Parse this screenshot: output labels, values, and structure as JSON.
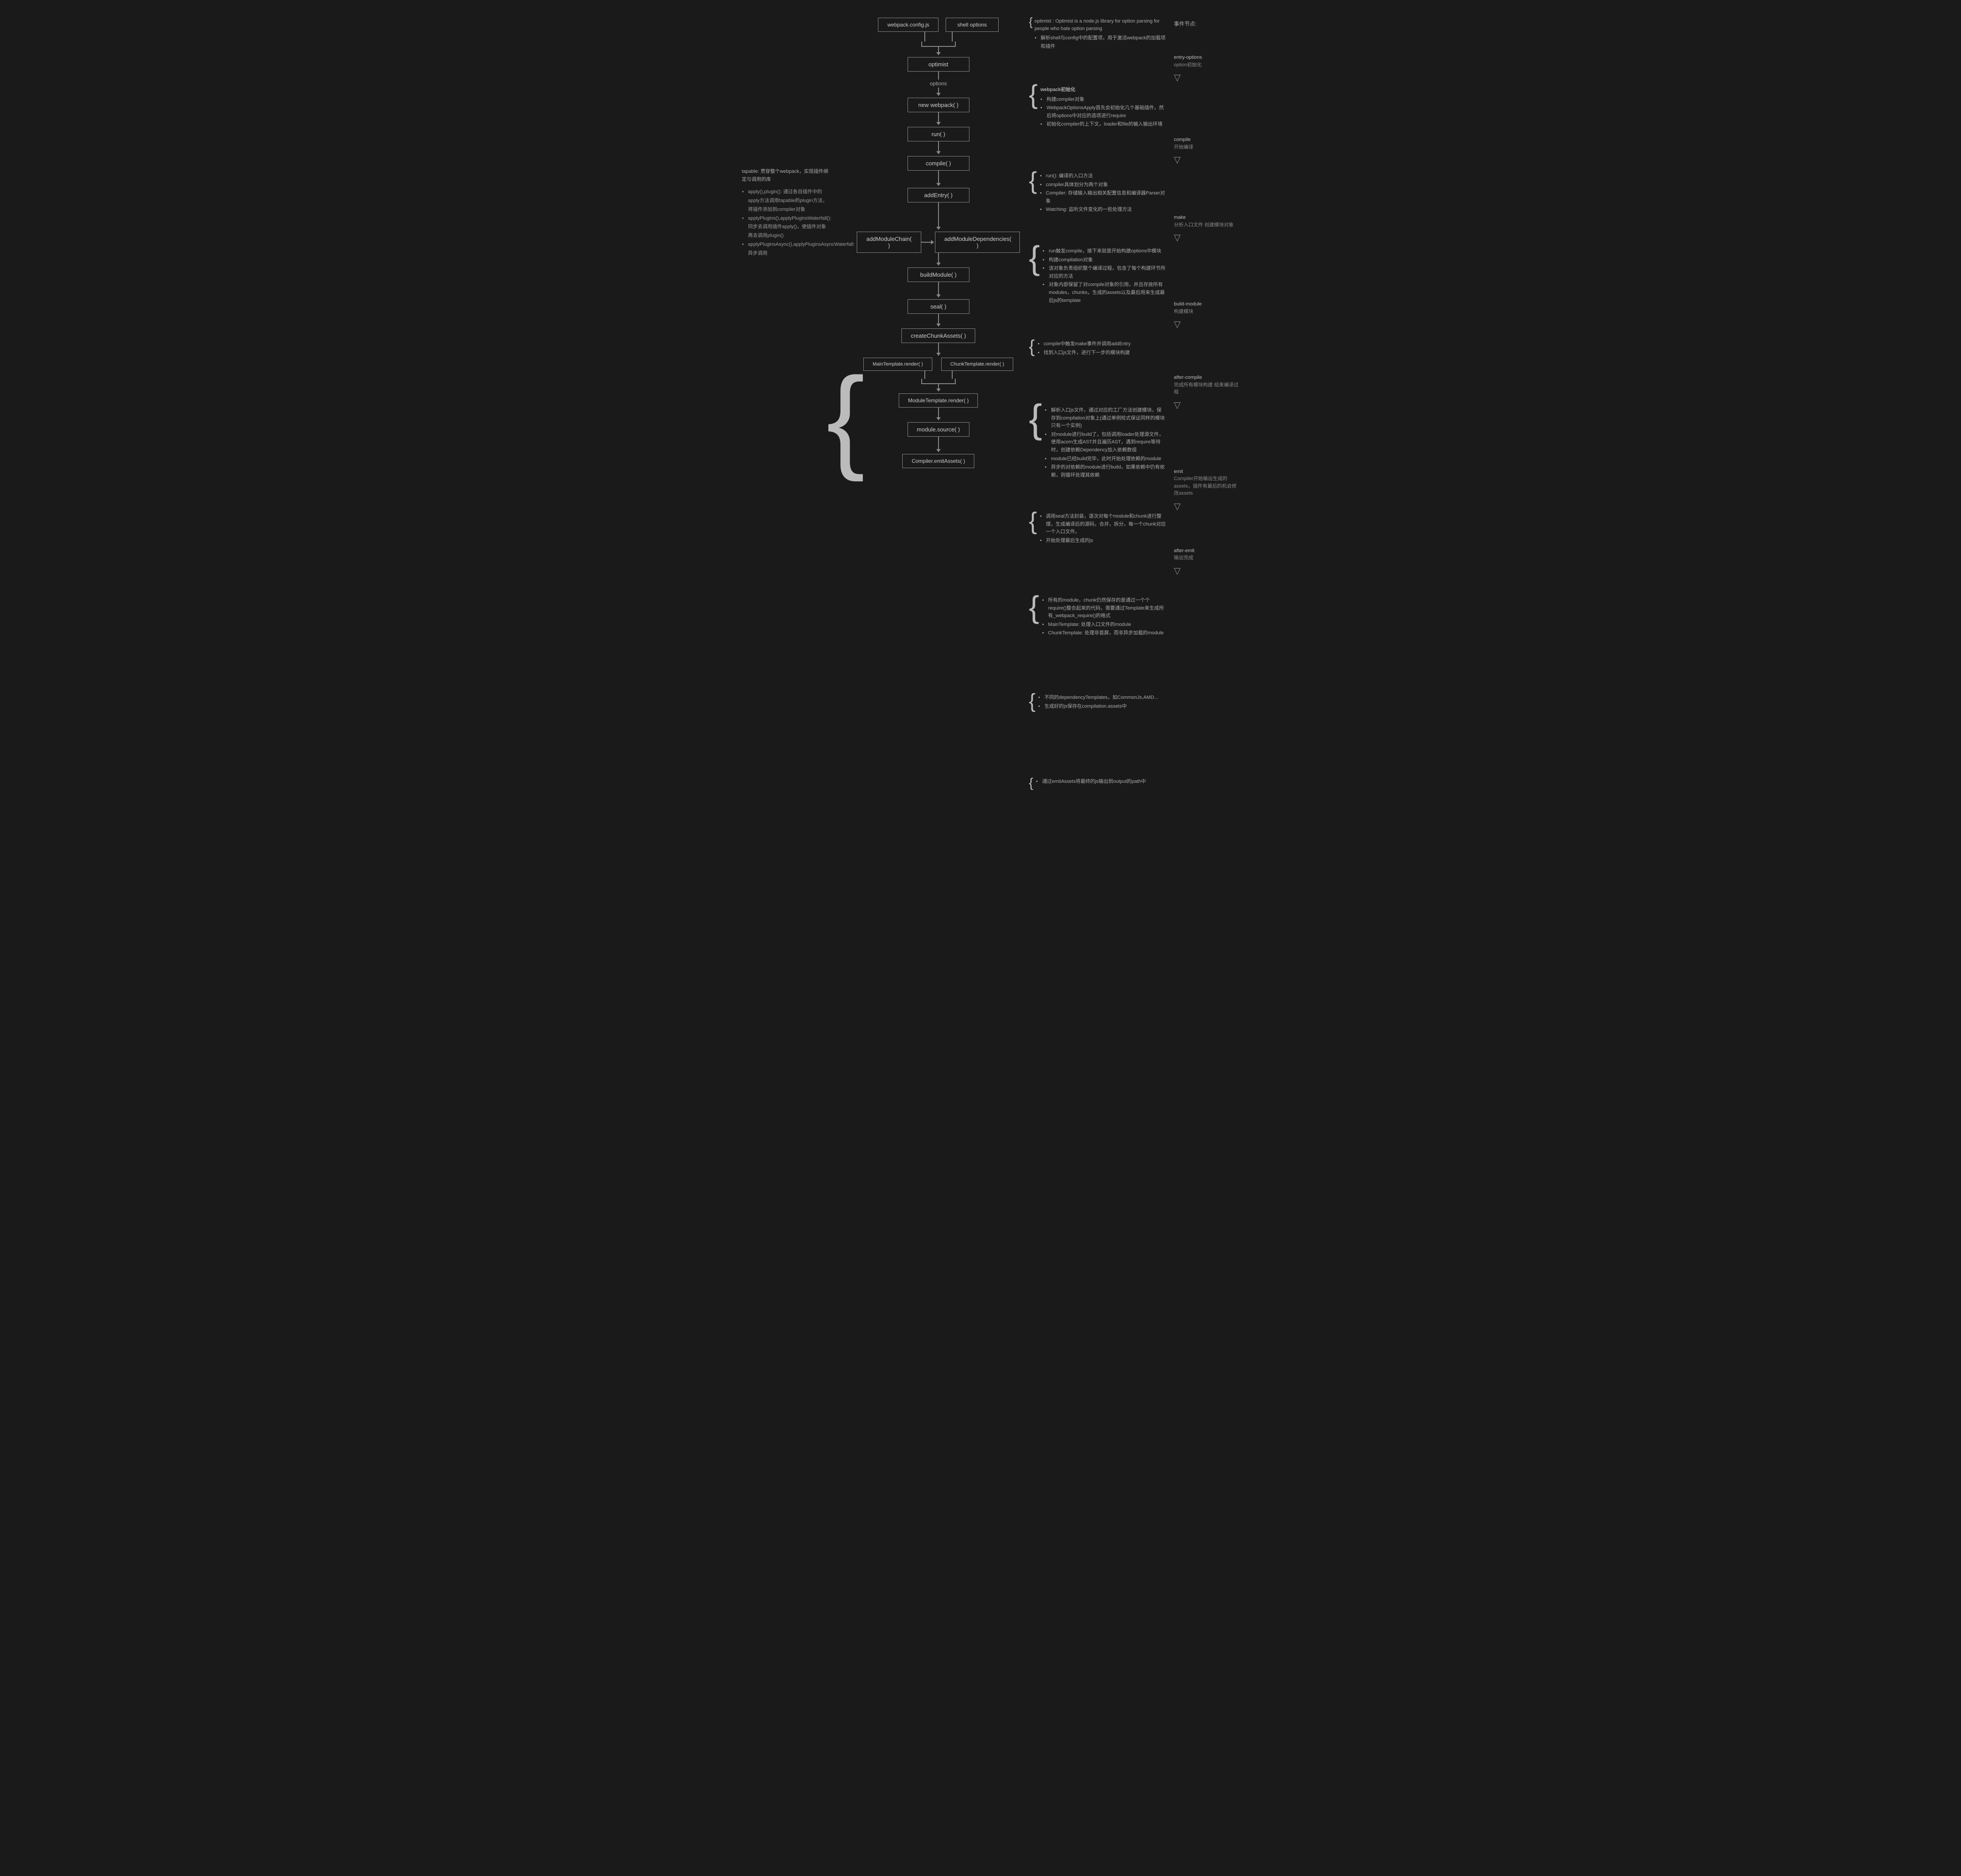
{
  "header": {
    "nodes": {
      "webpack_config": "webpack.config.js",
      "shell_options": "shell options",
      "optimist": "optimist",
      "new_webpack": "new webpack( )",
      "run": "run( )",
      "compile": "compile( )",
      "addEntry": "addEntry( )",
      "addModuleChain": "addModuleChain( )",
      "addModuleDependencies": "addModuleDependencies( )",
      "buildModule": "buildModule( )",
      "seal": "seal( )",
      "createChunkAssets": "createChunkAssets( )",
      "mainTemplateRender": "MainTemplate.render( )",
      "chunkTemplateRender": "ChunkTemplate.render( )",
      "moduleTemplateRender": "ModuleTemplate.render( )",
      "moduleSource": "module.source( )",
      "compilerEmitAssets": "Compiler.emitAssets( )"
    },
    "options_label": "options"
  },
  "left_panel": {
    "tapable_title": "tapable: 贯穿整个webpack，实现插件绑定与调用的库",
    "items": [
      "apply(),plugin(): 通过各自插件中的apply方法调用tapable的plugin方法，将插件添加到compiler对象",
      "applyPlugins(),applyPluginsWaterfall(): 同步去调用插件apply()，使插件对象再去调用plugin()",
      "applyPluginsAsync(),applyPluginsAsyncWaterfall: 异步调用"
    ]
  },
  "notes": {
    "optimist_note": {
      "title": "optimist : Optimist is a node.js library for option parsing for people who hate option parsing",
      "sub": "解析shell与config中的配置项，用于激活webpack的加载项和插件"
    },
    "new_webpack_note": {
      "title": "webpack初始化",
      "items": [
        "构建compiler对象",
        "WebpackOptionsApply首先会初始化几个基础插件，然后将options中对应的选项进行require",
        "初始化compiler的上下文，loader和file的输入输出环境"
      ]
    },
    "run_note": {
      "items": [
        "run(): 编译的入口方法",
        "compiler具体划分为两个对象",
        "Compiler: 存储输入输出相关配置信息和编译器Parser对象",
        "Watching: 监听文件变化的一些处理方法"
      ]
    },
    "compile_note": {
      "items": [
        "run触发compile，接下来就是开始构建options中模块",
        "构建compilation对象",
        "该对象负责组织整个编译过程，包含了每个构建环节所对应的方法",
        "对象内部保留了对compile对象的引用，并且存放所有modules，chunks，生成的assets以及最后用来生成最后js的template"
      ]
    },
    "addEntry_note": {
      "items": [
        "compile中触发make事件并调用addEntry",
        "找到入口js文件，进行下一步的模块构建"
      ]
    },
    "addModuleDeps_note": {
      "items": [
        "解析入口js文件，通过对应的工厂方法创建模块，保存到compilation对象上(通过单例校式保证同样的模块只有一个实例)",
        "对module进行build了，包括调用loader处理源文件，使用acorn生成AST并且遍历AST，遇到require等待时，创建依赖Dependency加入依赖数组",
        "module已经build完毕，此时开始处理依赖的module",
        "异步的对依赖的module进行build，如果依赖中仍有依赖，则循环处理其依赖"
      ]
    },
    "seal_note": {
      "items": [
        "调用seal方法封装，逐次对每个module和chunk进行整理，生成编译后的源码，合并，拆分，每一个chunk对应一个入口文件。",
        "开始处理最后生成的js"
      ]
    },
    "emit_note": {
      "items": [
        "所有的module，chunk仍然保存的是通过一个个require()整合起来的代码，需要通过Template来生成所有_webpack_require()的格式",
        "MainTemplate: 处理入口文件的module",
        "ChunkTemplate: 处理非首屏，而非异步加载的module"
      ]
    },
    "moduleTemplate_note": {
      "items": [
        "不同的dependencyTemplates，如CommonJs,AMD...",
        "生成好的js保存在compilation.assets中"
      ]
    },
    "compiler_emit_note": {
      "items": [
        "通过emitAssets将最终的js输出到output的path中"
      ]
    }
  },
  "right_events": {
    "entry_options": {
      "event": "entry-options",
      "desc": "option初始化"
    },
    "compile": {
      "event": "compile",
      "desc": "开始编译"
    },
    "make": {
      "event": "make",
      "desc": "分析入口文件 创建模块对象"
    },
    "build_module": {
      "event": "build-module",
      "desc": "构建模块"
    },
    "after_compile": {
      "event": "after-compile",
      "desc": "完成所有模块构建 结束编译过程"
    },
    "emit": {
      "event": "emit",
      "desc": "Compiler开始输出生成的assets，插件有最后的机会修改assets"
    },
    "after_emit": {
      "event": "after-emit",
      "desc": "输出完成"
    }
  }
}
